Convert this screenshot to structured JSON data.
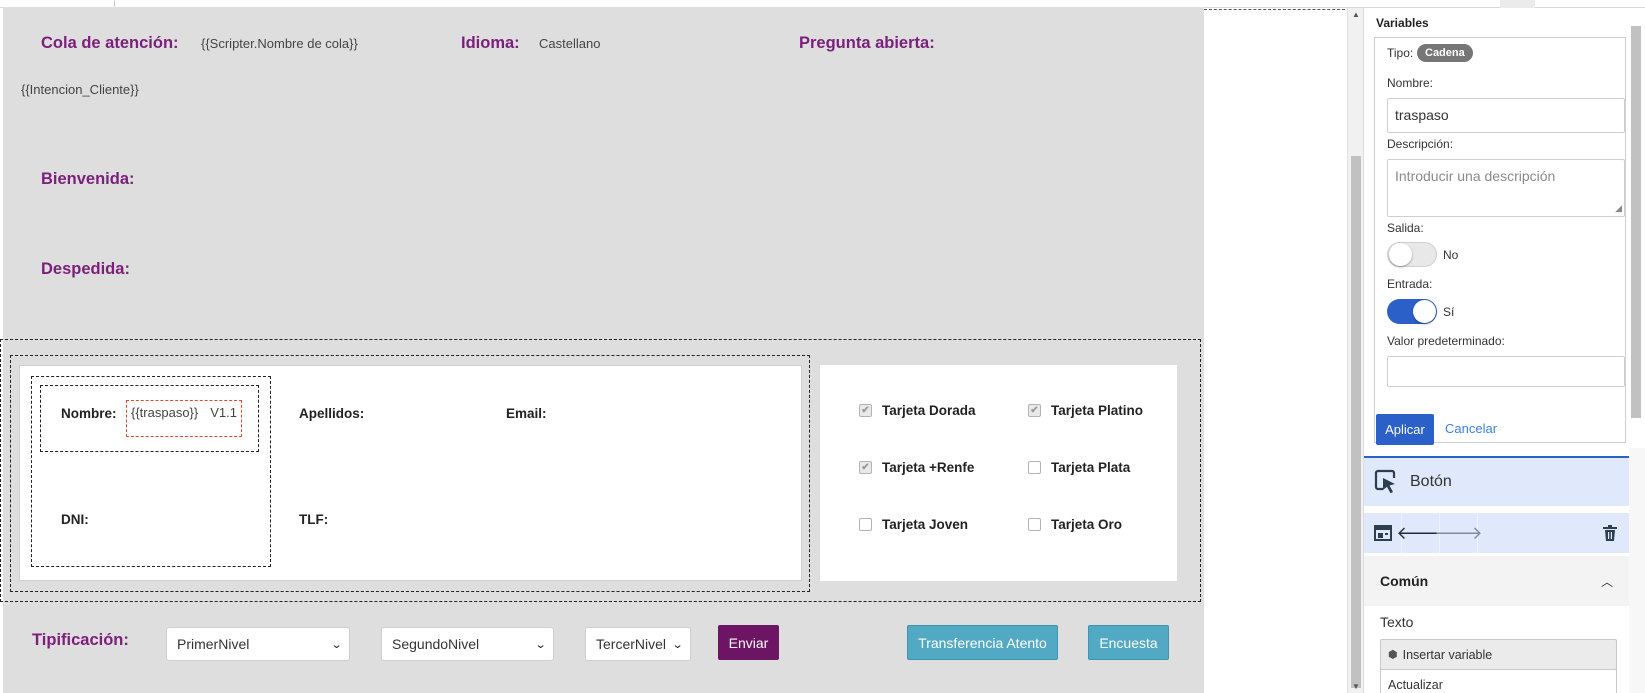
{
  "canvas": {
    "cola_label": "Cola de atención:",
    "cola_value": "{{Scripter.Nombre de cola}}",
    "idioma_label": "Idioma:",
    "idioma_value": "Castellano",
    "pregunta_label": "Pregunta abierta:",
    "intencion": "{{Intencion_Cliente}}",
    "bienvenida_label": "Bienvenida:",
    "despedida_label": "Despedida:"
  },
  "form": {
    "nombre_label": "Nombre:",
    "nombre_value": "{{traspaso}}",
    "version": "V1.1",
    "apellidos_label": "Apellidos:",
    "email_label": "Email:",
    "dni_label": "DNI:",
    "tlf_label": "TLF:"
  },
  "cards": [
    {
      "label": "Tarjeta Dorada",
      "checked": true
    },
    {
      "label": "Tarjeta Platino",
      "checked": true
    },
    {
      "label": "Tarjeta +Renfe",
      "checked": true
    },
    {
      "label": "Tarjeta Plata",
      "checked": false
    },
    {
      "label": "Tarjeta Joven",
      "checked": false
    },
    {
      "label": "Tarjeta Oro",
      "checked": false
    }
  ],
  "tipificacion": {
    "label": "Tipificación:",
    "select1": "PrimerNivel",
    "select2": "SegundoNivel",
    "select3": "TercerNivel",
    "enviar": "Enviar",
    "transferencia": "Transferencia Atento",
    "encuesta": "Encuesta"
  },
  "panel": {
    "title": "Variables",
    "tipo_label": "Tipo:",
    "tipo_value": "Cadena",
    "nombre_label": "Nombre:",
    "nombre_value": "traspaso",
    "descripcion_label": "Descripción:",
    "descripcion_placeholder": "Introducir una descripción",
    "salida_label": "Salida:",
    "salida_value": "No",
    "salida_on": false,
    "entrada_label": "Entrada:",
    "entrada_value": "Sí",
    "entrada_on": true,
    "valor_label": "Valor predeterminado:",
    "valor_value": "",
    "aplicar": "Aplicar",
    "cancelar": "Cancelar",
    "component_title": "Botón",
    "section_title": "Común",
    "texto_label": "Texto",
    "insertar_variable": "Insertar variable",
    "texto_value": "Actualizar"
  },
  "colors": {
    "accent_purple": "#7b1f7c",
    "enviar_bg": "#6d1464",
    "teal_button": "#52a9c4",
    "primary_blue": "#2a60c8",
    "canvas_bg": "#dedede"
  }
}
